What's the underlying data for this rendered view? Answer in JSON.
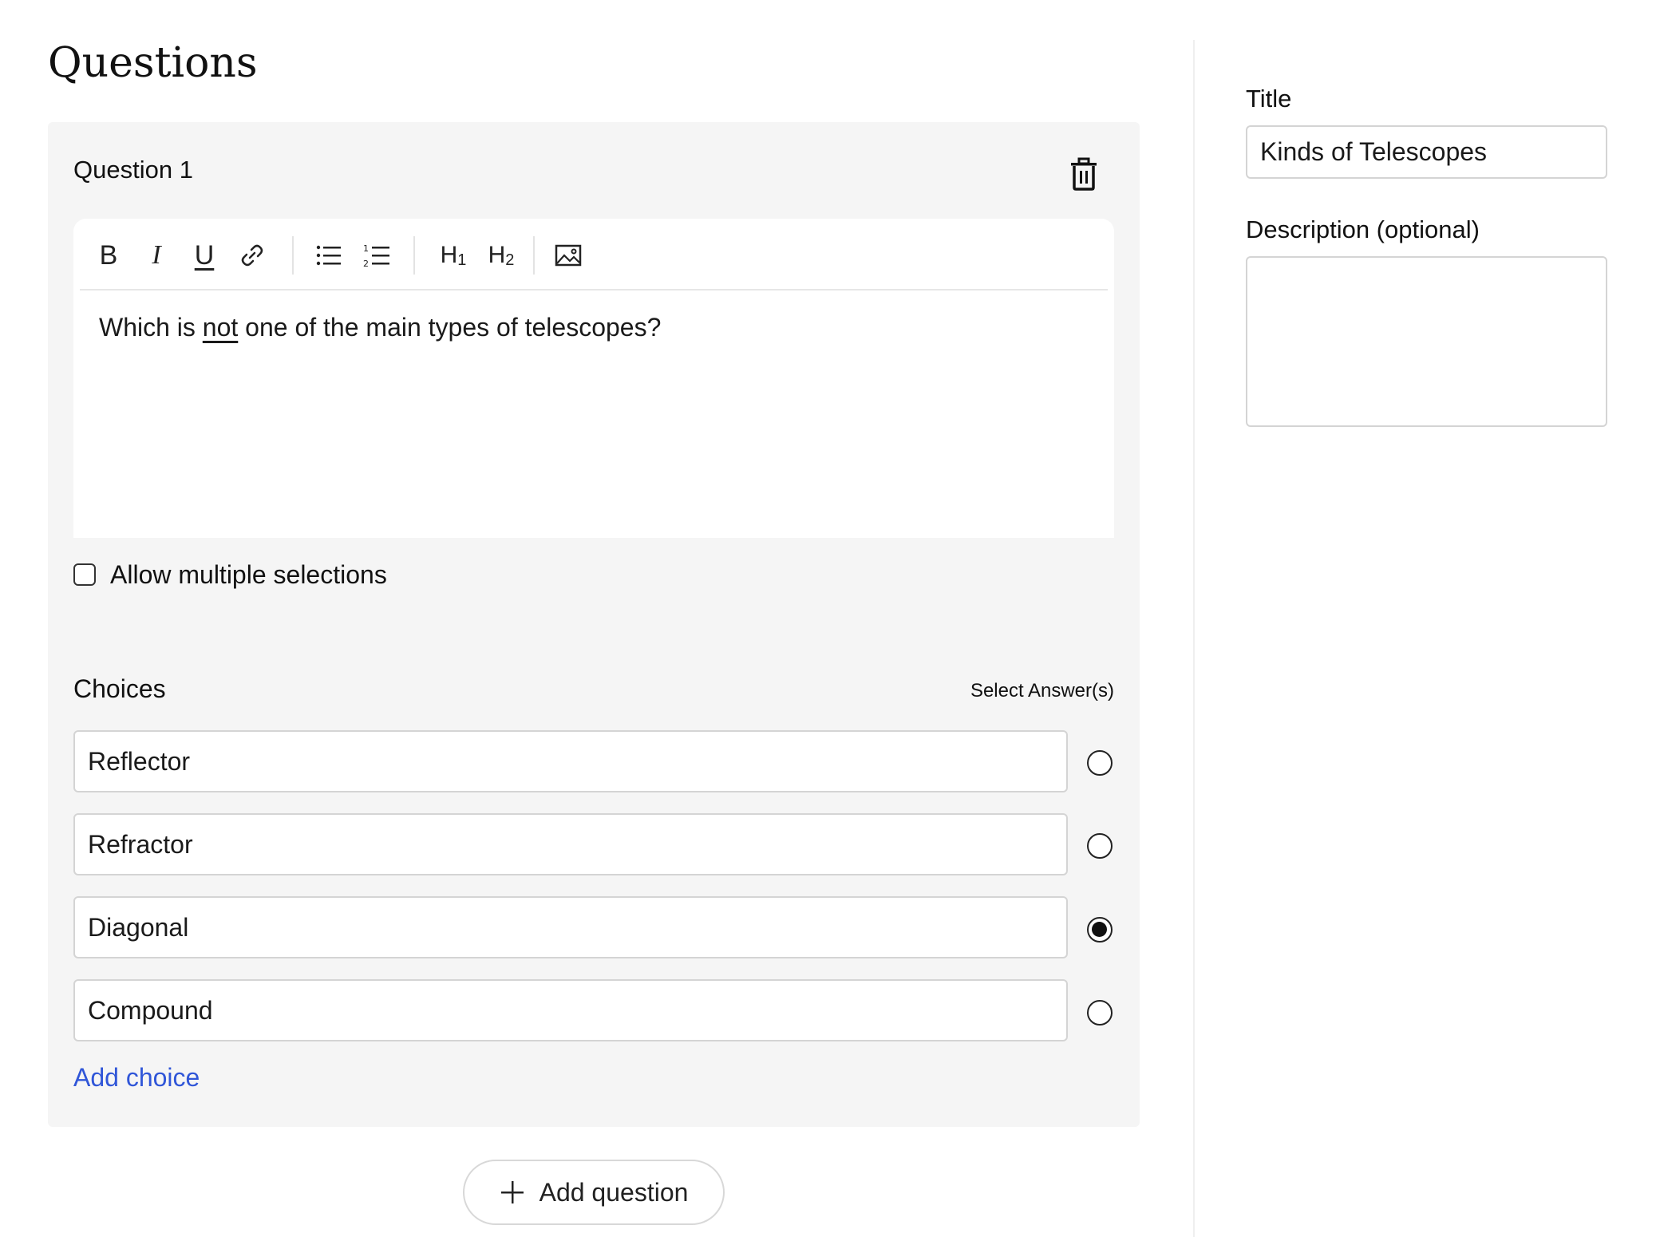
{
  "page_title": "Questions",
  "question": {
    "heading": "Question 1",
    "toolbar": {
      "bold": "B",
      "italic": "I",
      "underline": "U",
      "h1": "H",
      "h1_sub": "1",
      "h2": "H",
      "h2_sub": "2",
      "icons": [
        "link-icon",
        "bullet-list-icon",
        "numbered-list-icon",
        "image-icon",
        "trash-icon"
      ]
    },
    "text_before": "Which is ",
    "text_underlined": "not",
    "text_after": " one of the main types of telescopes?",
    "allow_multiple_label": "Allow multiple selections",
    "allow_multiple_checked": false,
    "choices_title": "Choices",
    "select_answers_label": "Select Answer(s)",
    "choices": [
      {
        "text": "Reflector",
        "selected": false
      },
      {
        "text": "Refractor",
        "selected": false
      },
      {
        "text": "Diagonal",
        "selected": true
      },
      {
        "text": "Compound",
        "selected": false
      }
    ],
    "add_choice_label": "Add choice"
  },
  "add_question_label": "Add question",
  "settings": {
    "title_label": "Title",
    "title_value": "Kinds of Telescopes",
    "description_label": "Description (optional)",
    "description_value": ""
  },
  "colors": {
    "link": "#3056d8",
    "card_bg": "#f5f5f5"
  }
}
